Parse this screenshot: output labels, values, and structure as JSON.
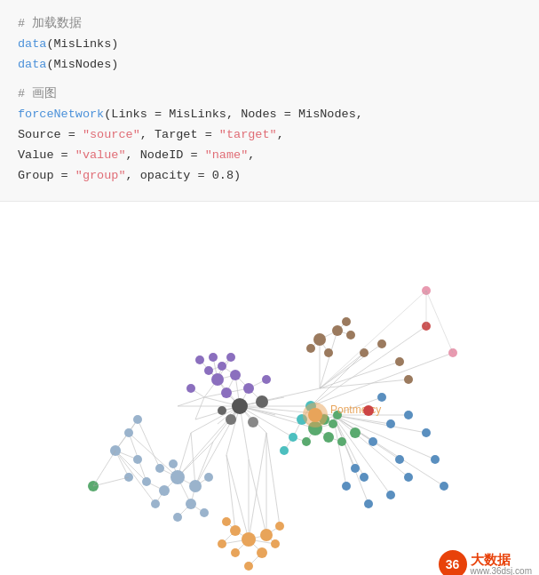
{
  "code": {
    "comment1": "# 加载数据",
    "line1": "data(MisLinks)",
    "line2": "data(MisNodes)",
    "comment2": "# 画图",
    "line3_func": "forceNetwork",
    "line3_params": "(Links = MisLinks, Nodes = MisNodes,",
    "line4": "Source = \"source\", Target = \"target\",",
    "line5": "Value = \"value\", NodeID = \"name\",",
    "line6": "Group = \"group\", opacity = 0.8)"
  },
  "graph": {
    "label": "Pontmercy"
  },
  "watermark": {
    "circle_text": "36",
    "big_text": "大数据",
    "small_text": "www.36dsj.com"
  }
}
